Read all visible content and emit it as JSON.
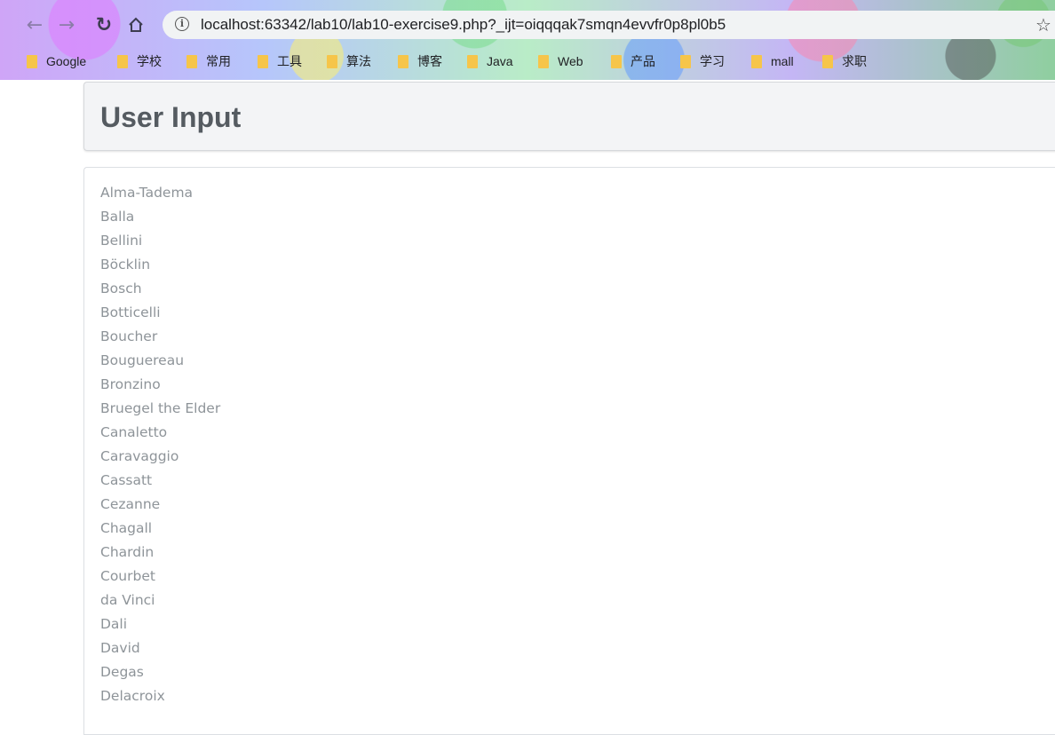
{
  "browser": {
    "url": "localhost:63342/lab10/lab10-exercise9.php?_ijt=oiqqqak7smqn4evvfr0p8pl0b5",
    "bookmarks": [
      "Google",
      "学校",
      "常用",
      "工具",
      "算法",
      "博客",
      "Java",
      "Web",
      "产品",
      "学习",
      "mall",
      "求职"
    ]
  },
  "page": {
    "title": "User Input",
    "artists": [
      "Alma-Tadema",
      "Balla",
      "Bellini",
      "Böcklin",
      "Bosch",
      "Botticelli",
      "Boucher",
      "Bouguereau",
      "Bronzino",
      "Bruegel the Elder",
      "Canaletto",
      "Caravaggio",
      "Cassatt",
      "Cezanne",
      "Chagall",
      "Chardin",
      "Courbet",
      "da Vinci",
      "Dali",
      "David",
      "Degas",
      "Delacroix"
    ]
  },
  "icons": {
    "back": "arrow-left-icon",
    "forward": "arrow-right-icon",
    "reload": "reload-icon",
    "home": "home-icon",
    "info": "info-icon",
    "bookmark_star": "star-icon",
    "bookmark_folder": "folder-icon"
  },
  "colors": {
    "folder": "#f6c54a",
    "title_text": "#555b61",
    "list_text": "#8e9499",
    "header_bg": "#f3f4f6"
  }
}
